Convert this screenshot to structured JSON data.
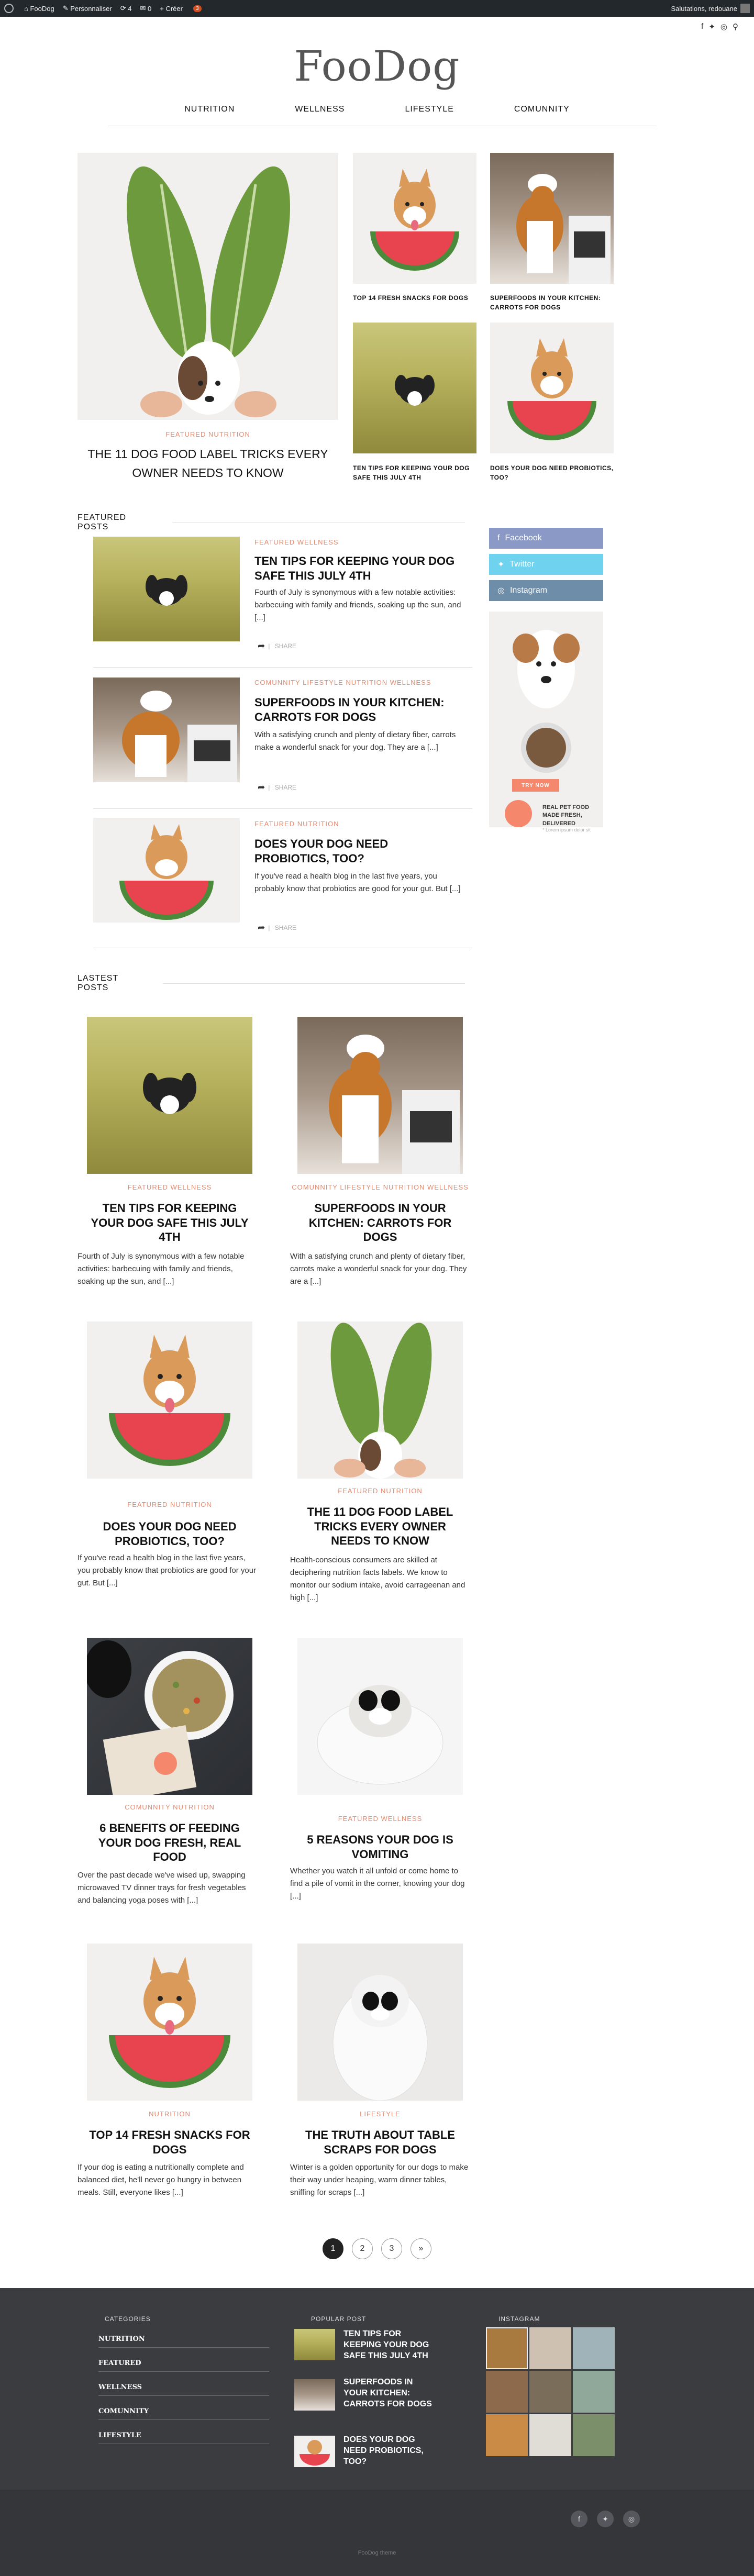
{
  "admin_bar": {
    "site": "FooDog",
    "customize": "Personnaliser",
    "updates": "4",
    "comments": "0",
    "new": "Créer",
    "badge": "3",
    "greeting": "Salutations, redouane"
  },
  "site": {
    "logo": "FooDog",
    "nav": [
      "NUTRITION",
      "WELLNESS",
      "LIFESTYLE",
      "COMUNNITY"
    ]
  },
  "hero": {
    "category": "FEATURED NUTRITION",
    "title": "THE 11 DOG FOOD LABEL TRICKS EVERY OWNER NEEDS TO KNOW"
  },
  "hero_grid": [
    {
      "title": "TOP 14 FRESH SNACKS FOR DOGS"
    },
    {
      "title": "SUPERFOODS IN YOUR KITCHEN: CARROTS FOR DOGS"
    },
    {
      "title": "TEN TIPS FOR KEEPING YOUR DOG SAFE THIS JULY 4TH"
    },
    {
      "title": "DOES YOUR DOG NEED PROBIOTICS, TOO?"
    }
  ],
  "featured": {
    "heading": "FEATURED POSTS",
    "share_label": "SHARE",
    "posts": [
      {
        "category": "FEATURED WELLNESS",
        "title": "TEN TIPS FOR KEEPING YOUR DOG SAFE THIS JULY 4TH",
        "excerpt": "Fourth of July is synonymous with a few notable activities: barbecuing with family and friends, soaking up the sun, and [...]"
      },
      {
        "category": "COMUNNITY LIFESTYLE NUTRITION WELLNESS",
        "title": "SUPERFOODS IN YOUR KITCHEN: CARROTS FOR DOGS",
        "excerpt": "With a satisfying crunch and plenty of dietary fiber, carrots make a wonderful snack for your dog. They are a [...]"
      },
      {
        "category": "FEATURED NUTRITION",
        "title": "DOES YOUR DOG NEED PROBIOTICS, TOO?",
        "excerpt": "If you've read a health blog in the last five years, you probably know that probiotics are good for your gut. But [...]"
      }
    ]
  },
  "sidebar": {
    "facebook": "Facebook",
    "twitter": "Twitter",
    "instagram": "Instagram",
    "ad_cta": "TRY NOW",
    "ad_text": "REAL PET FOOD MADE FRESH, DELIVERED",
    "ad_sub": "* Lorem ipsum dolor sit"
  },
  "latest": {
    "heading": "LASTEST POSTS",
    "posts": [
      {
        "category": "FEATURED WELLNESS",
        "title": "TEN TIPS FOR KEEPING YOUR DOG SAFE THIS JULY 4TH",
        "excerpt": "Fourth of July is synonymous with a few notable activities: barbecuing with family and friends, soaking up the sun, and [...]"
      },
      {
        "category": "COMUNNITY LIFESTYLE NUTRITION WELLNESS",
        "title": "SUPERFOODS IN YOUR KITCHEN: CARROTS FOR DOGS",
        "excerpt": "With a satisfying crunch and plenty of dietary fiber, carrots make a wonderful snack for your dog. They are a [...]"
      },
      {
        "category": "FEATURED NUTRITION",
        "title": "DOES YOUR DOG NEED PROBIOTICS, TOO?",
        "excerpt": "If you've read a health blog in the last five years, you probably know that probiotics are good for your gut. But [...]"
      },
      {
        "category": "FEATURED NUTRITION",
        "title": "THE 11 DOG FOOD LABEL TRICKS EVERY OWNER NEEDS TO KNOW",
        "excerpt": "Health-conscious consumers are skilled at deciphering nutrition facts labels. We know to monitor our sodium intake, avoid carrageenan and high [...]"
      },
      {
        "category": "COMUNNITY NUTRITION",
        "title": "6 BENEFITS OF FEEDING YOUR DOG FRESH, REAL FOOD",
        "excerpt": "Over the past decade we've wised up, swapping microwaved TV dinner trays for fresh vegetables and balancing yoga poses with [...]"
      },
      {
        "category": "FEATURED WELLNESS",
        "title": "5 REASONS YOUR DOG IS VOMITING",
        "excerpt": "Whether you watch it all unfold or come home to find a pile of vomit in the corner, knowing your dog [...]"
      },
      {
        "category": "NUTRITION",
        "title": "TOP 14 FRESH SNACKS FOR DOGS",
        "excerpt": "If your dog is eating a nutritionally complete and balanced diet, he'll never go hungry in between meals. Still, everyone likes [...]"
      },
      {
        "category": "LIFESTYLE",
        "title": "THE TRUTH ABOUT TABLE SCRAPS FOR DOGS",
        "excerpt": "Winter is a golden opportunity for our dogs to make their way under heaping, warm dinner tables, sniffing for scraps [...]"
      }
    ]
  },
  "pagination": [
    "1",
    "2",
    "3",
    "»"
  ],
  "footer": {
    "categories_title": "CATEGORIES",
    "categories": [
      "NUTRITION",
      "FEATURED",
      "WELLNESS",
      "COMUNNITY",
      "LIFESTYLE"
    ],
    "popular_title": "POPULAR POST",
    "popular": [
      "TEN TIPS FOR KEEPING YOUR DOG SAFE THIS JULY 4TH",
      "SUPERFOODS IN YOUR KITCHEN: CARROTS FOR DOGS",
      "DOES YOUR DOG NEED PROBIOTICS, TOO?"
    ],
    "instagram_title": "INSTAGRAM",
    "copyright": "FooDog theme"
  },
  "colors": {
    "accent": "#e8886c",
    "facebook": "#8a99c6",
    "twitter": "#6fd2ee",
    "instagram": "#6d8da9",
    "footer": "#3b3c40"
  }
}
